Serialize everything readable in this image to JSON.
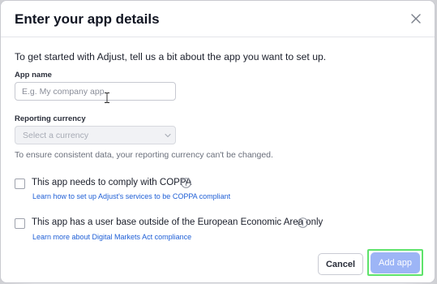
{
  "modal": {
    "title": "Enter your app details",
    "intro": "To get started with Adjust, tell us a bit about the app you want to set up."
  },
  "app_name": {
    "label": "App name",
    "placeholder": "E.g. My company app",
    "value": ""
  },
  "currency": {
    "label": "Reporting currency",
    "placeholder": "Select a currency",
    "disabled": true,
    "helper": "To ensure consistent data, your reporting currency can't be changed."
  },
  "coppa": {
    "label": "This app needs to comply with COPPA",
    "checked": false,
    "link": "Learn how to set up Adjust's services to be COPPA compliant",
    "icon": "info-icon"
  },
  "eea": {
    "label": "This app has a user base outside of the European Economic Area only",
    "checked": false,
    "link": "Learn more about Digital Markets Act compliance",
    "icon": "info-icon"
  },
  "footer": {
    "cancel_label": "Cancel",
    "add_label": "Add app"
  },
  "colors": {
    "primary_disabled": "#9db5f6",
    "link": "#1f5fd6",
    "highlight": "#5ee36a"
  }
}
